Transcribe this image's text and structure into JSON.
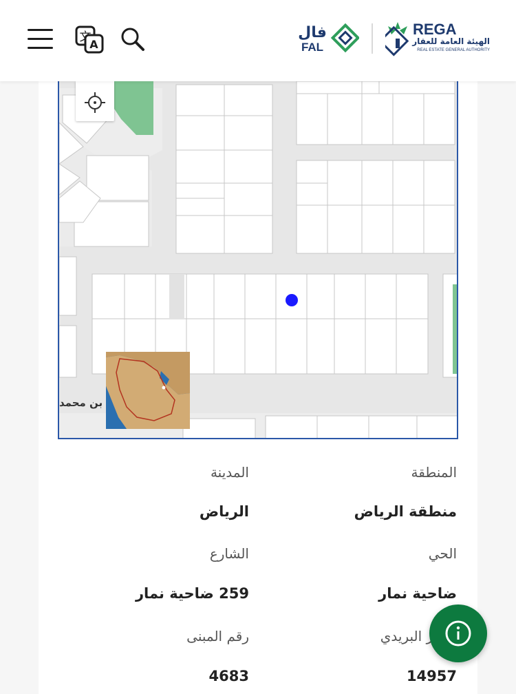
{
  "header": {
    "menu_icon": "hamburger-menu-icon",
    "translate_icon": "translate-icon",
    "search_icon": "search-icon",
    "fal_logo": {
      "arabic": "فال",
      "latin": "FAL"
    },
    "rega_logo": {
      "latin": "REGA",
      "arabic": "الهيئة العامة للعقار",
      "english": "REAL ESTATE GENERAL AUTHORITY"
    }
  },
  "map": {
    "locate_icon": "crosshair-icon",
    "street_label": "د بن محمد",
    "marker_color": "#1a1aff",
    "border_color": "#2a57a8",
    "park_color": "#7fc492"
  },
  "details": {
    "region_label": "المنطقة",
    "region_value": "منطقة الرياض",
    "city_label": "المدينة",
    "city_value": "الرياض",
    "district_label": "الحي",
    "district_value": "ضاحية نمار",
    "street_label": "الشارع",
    "street_value": "259 ضاحية نمار",
    "postal_label": "الرمز البريدي",
    "postal_value": "14957",
    "building_label": "رقم المبنى",
    "building_value": "4683"
  },
  "fab": {
    "icon": "info-icon",
    "color": "#0d7a3f"
  }
}
